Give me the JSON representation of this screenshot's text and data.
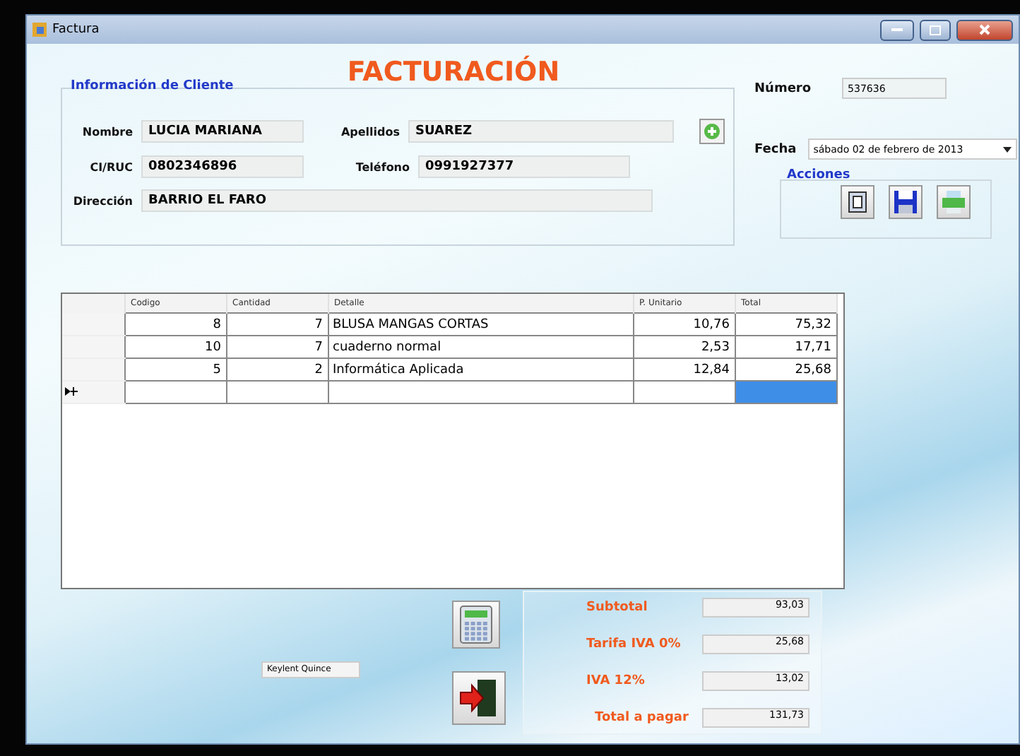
{
  "window": {
    "title": "Factura"
  },
  "heading": "FACTURACIÓN",
  "client_group": {
    "title": "Información de Cliente",
    "fields": [
      {
        "label": "Nombre",
        "value": "LUCIA MARIANA"
      },
      {
        "label": "Apellidos",
        "value": "SUAREZ"
      },
      {
        "label": "CI/RUC",
        "value": "0802346896"
      },
      {
        "label": "Teléfono",
        "value": "0991927377"
      },
      {
        "label": "Dirección",
        "value": "BARRIO EL FARO"
      }
    ]
  },
  "numero": {
    "label": "Número",
    "value": "537636"
  },
  "fecha": {
    "label": "Fecha",
    "value": "sábado 02 de febrero de 2013"
  },
  "actions": {
    "title": "Acciones"
  },
  "table": {
    "columns": [
      "Codigo",
      "Cantidad",
      "Detalle",
      "P. Unitario",
      "Total"
    ],
    "rows": [
      {
        "new": false,
        "cells": [
          {
            "text": "8",
            "selected": false
          },
          {
            "text": "7",
            "selected": false
          },
          {
            "text": "BLUSA MANGAS CORTAS",
            "selected": false
          },
          {
            "text": "10,76",
            "selected": false
          },
          {
            "text": "75,32",
            "selected": false
          }
        ]
      },
      {
        "new": false,
        "cells": [
          {
            "text": "10",
            "selected": false
          },
          {
            "text": "7",
            "selected": false
          },
          {
            "text": "cuaderno normal",
            "selected": false
          },
          {
            "text": "2,53",
            "selected": false
          },
          {
            "text": "17,71",
            "selected": false
          }
        ]
      },
      {
        "new": false,
        "cells": [
          {
            "text": "5",
            "selected": false
          },
          {
            "text": "2",
            "selected": false
          },
          {
            "text": "Informática Aplicada",
            "selected": false
          },
          {
            "text": "12,84",
            "selected": false
          },
          {
            "text": "25,68",
            "selected": false
          }
        ]
      },
      {
        "new": true,
        "cells": [
          {
            "selected": false
          },
          {
            "selected": false
          },
          {
            "selected": false
          },
          {
            "selected": false
          },
          {
            "selected": true
          }
        ]
      }
    ]
  },
  "user_field": {
    "value": "Keylent Quince"
  },
  "totals": [
    {
      "label": "Subtotal",
      "value": "93,03"
    },
    {
      "label": "Tarifa IVA  0%",
      "value": "25,68"
    },
    {
      "label": "IVA 12%",
      "value": "13,02"
    },
    {
      "label": "Total a pagar",
      "value": "131,73"
    }
  ]
}
